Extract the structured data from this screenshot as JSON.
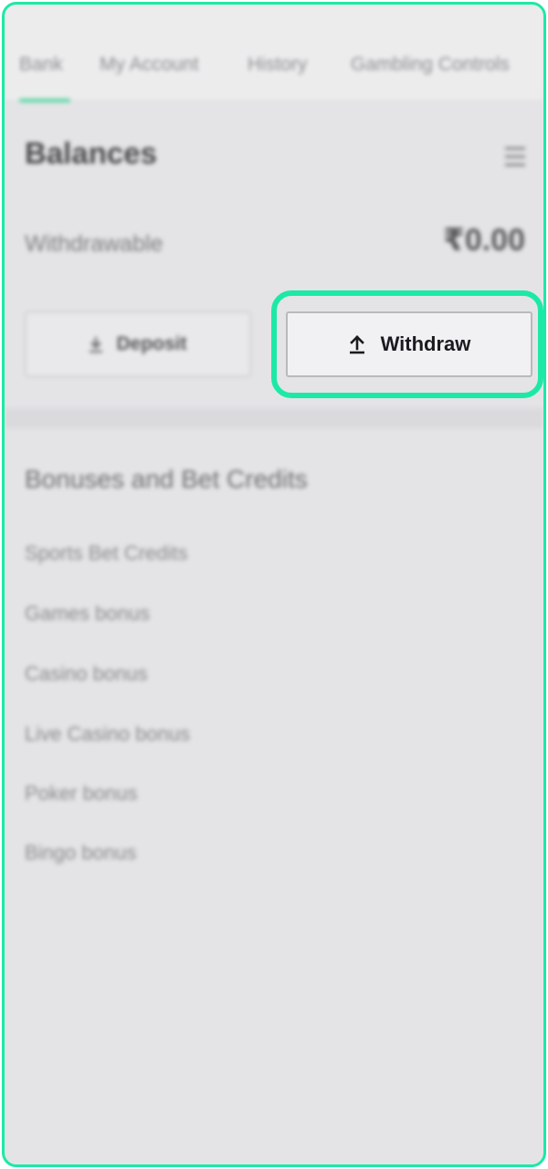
{
  "tabs": [
    {
      "label": "Bank"
    },
    {
      "label": "My Account"
    },
    {
      "label": "History"
    },
    {
      "label": "Gambling Controls"
    }
  ],
  "balances": {
    "title": "Balances",
    "withdrawable_label": "Withdrawable",
    "withdrawable_value": "₹0.00"
  },
  "actions": {
    "deposit_label": "Deposit",
    "withdraw_label": "Withdraw"
  },
  "bonuses": {
    "title": "Bonuses and Bet Credits",
    "items": [
      {
        "label": "Sports Bet Credits"
      },
      {
        "label": "Games bonus"
      },
      {
        "label": "Casino bonus"
      },
      {
        "label": "Live Casino bonus"
      },
      {
        "label": "Poker bonus"
      },
      {
        "label": "Bingo bonus"
      }
    ]
  },
  "colors": {
    "highlight": "#1de9a6",
    "tab_active_underline": "#58d9a4",
    "background": "#e4e4e6"
  },
  "icons": {
    "menu": "hamburger-icon",
    "deposit": "download-icon",
    "withdraw": "upload-icon"
  }
}
